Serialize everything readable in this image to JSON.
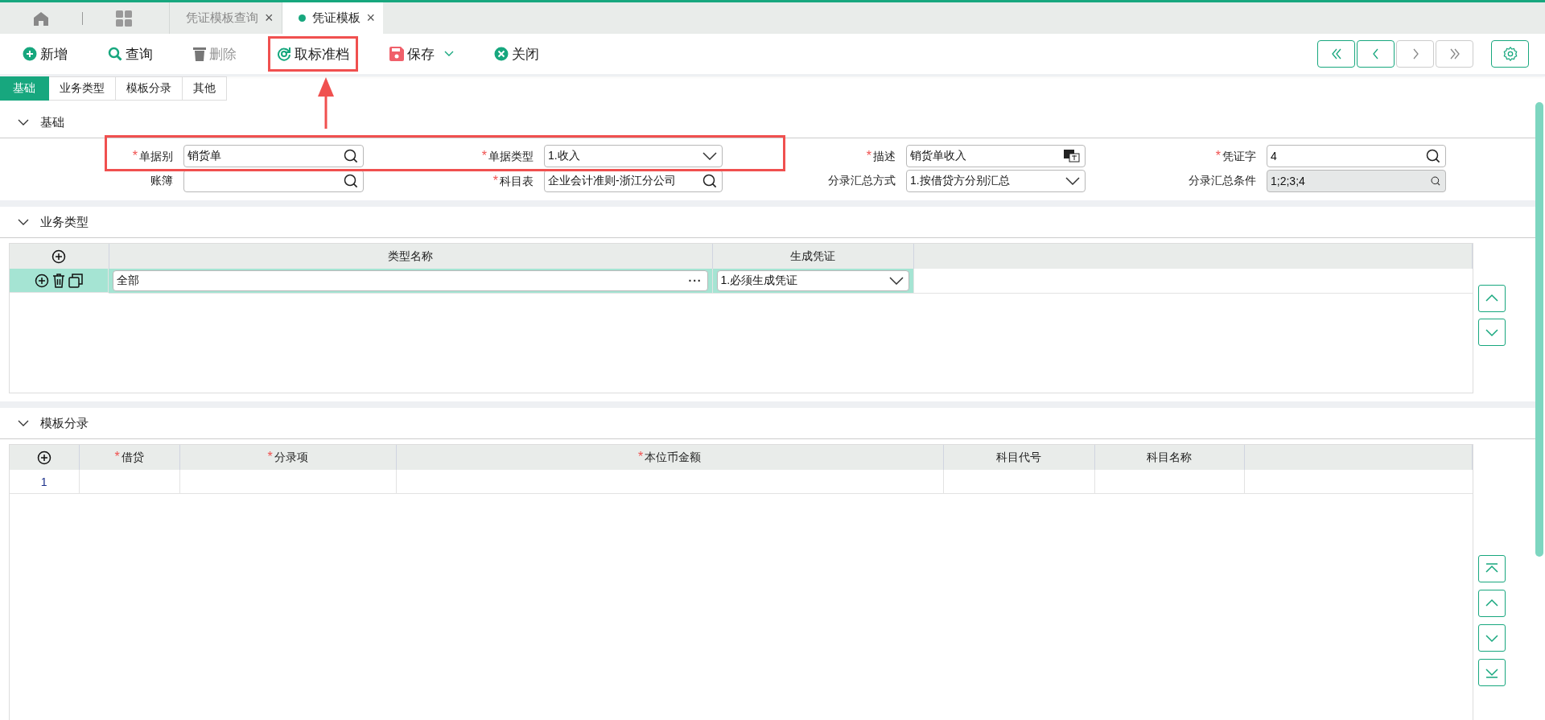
{
  "tabs": [
    {
      "label": "凭证模板查询",
      "close": "×",
      "selected": false
    },
    {
      "label": "凭证模板",
      "close": "×",
      "selected": true
    }
  ],
  "toolbar": [
    {
      "label": "新增",
      "kind": "add",
      "disabled": false,
      "highlighted": false,
      "menu": false
    },
    {
      "label": "查询",
      "kind": "search",
      "disabled": false,
      "highlighted": false,
      "menu": false
    },
    {
      "label": "删除",
      "kind": "delete",
      "disabled": true,
      "highlighted": false,
      "menu": false
    },
    {
      "label": "取标准档",
      "kind": "reset",
      "disabled": false,
      "highlighted": true,
      "menu": false
    },
    {
      "label": "保存",
      "kind": "save",
      "disabled": false,
      "highlighted": false,
      "menu": true
    },
    {
      "label": "关闭",
      "kind": "close",
      "disabled": false,
      "highlighted": false,
      "menu": false
    }
  ],
  "nav_buttons": [
    {
      "kind": "first",
      "disabled": false
    },
    {
      "kind": "prev",
      "disabled": false
    },
    {
      "kind": "next",
      "disabled": true
    },
    {
      "kind": "last",
      "disabled": true
    }
  ],
  "sub_tabs": [
    {
      "label": "基础",
      "selected": true
    },
    {
      "label": "业务类型",
      "selected": false
    },
    {
      "label": "模板分录",
      "selected": false
    },
    {
      "label": "其他",
      "selected": false
    }
  ],
  "annotation": {
    "form_box": true,
    "arrow": true
  },
  "basic": {
    "title": "基础",
    "expanded": true,
    "fields": [
      {
        "label": "单据别",
        "required_mark": "*",
        "value": "销货单",
        "kind": "lookup",
        "disabled": false
      },
      {
        "label": "单据类型",
        "required_mark": "*",
        "value": "1.收入",
        "kind": "select",
        "disabled": false
      },
      {
        "label": "描述",
        "required_mark": "*",
        "value": "销货单收入",
        "kind": "lang",
        "disabled": false
      },
      {
        "label": "凭证字",
        "required_mark": "*",
        "value": "4",
        "kind": "lookup",
        "disabled": false
      },
      {
        "label": "账簿",
        "kind": "lookup",
        "disabled": false
      },
      {
        "label": "科目表",
        "required_mark": "*",
        "value": "企业会计准则-浙江分公司",
        "kind": "lookup",
        "disabled": false
      },
      {
        "label": "分录汇总方式",
        "value": "1.按借贷方分别汇总",
        "kind": "select",
        "disabled": false
      },
      {
        "label": "分录汇总条件",
        "value": "1;2;3;4",
        "kind": "lookup",
        "disabled": true
      }
    ]
  },
  "business_types": {
    "title": "业务类型",
    "expanded": true,
    "columns": [
      "类型名称",
      "生成凭证"
    ],
    "rows": [
      {
        "name": "全部",
        "more": "···",
        "voucher": "1.必须生成凭证",
        "selected": true
      }
    ]
  },
  "entries": {
    "title": "模板分录",
    "expanded": true,
    "columns": [
      {
        "label": "借贷",
        "required_mark": "*"
      },
      {
        "label": "分录项",
        "required_mark": "*"
      },
      {
        "label": "本位币金额",
        "required_mark": "*"
      },
      {
        "label": "科目代号"
      },
      {
        "label": "科目名称"
      }
    ],
    "rows": [
      {
        "index": "1"
      }
    ]
  }
}
